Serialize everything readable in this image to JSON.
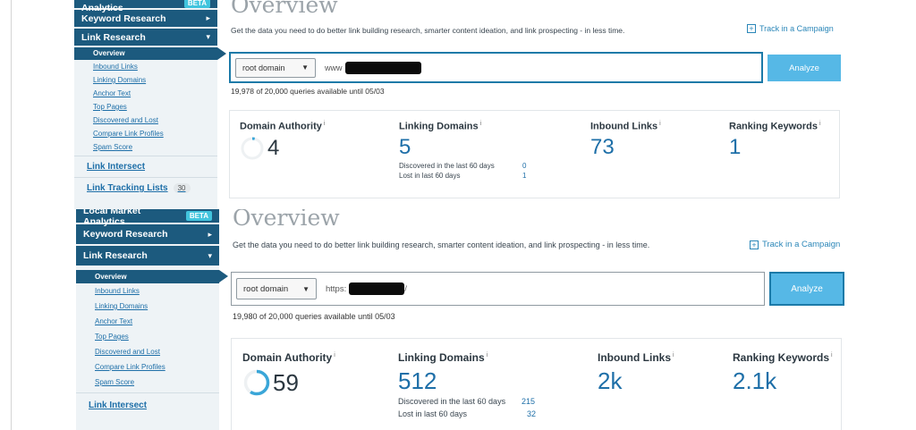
{
  "panels": [
    {
      "sidebar": {
        "local_market": "Local Market Analytics",
        "local_market_badge": "BETA",
        "keyword_research": "Keyword Research",
        "link_research": "Link Research",
        "subnav": [
          "Overview",
          "Inbound Links",
          "Linking Domains",
          "Anchor Text",
          "Top Pages",
          "Discovered and Lost",
          "Compare Link Profiles",
          "Spam Score"
        ],
        "link_intersect": "Link Intersect",
        "link_tracking": "Link Tracking Lists",
        "link_tracking_count": "30"
      },
      "main": {
        "title": "Overview",
        "subtitle": "Get the data you need to do better link building research, smarter content ideation, and link prospecting - in less time.",
        "track_campaign": "Track in a Campaign",
        "select_value": "root domain",
        "url_prefix": "www",
        "url_suffix": "",
        "analyze_label": "Analyze",
        "queries": "19,978 of 20,000 queries available until 05/03"
      },
      "metrics": {
        "domain_authority_label": "Domain Authority",
        "domain_authority_value": "4",
        "domain_authority_fraction": 0.04,
        "linking_domains_label": "Linking Domains",
        "linking_domains_value": "5",
        "discovered_label": "Discovered in the last 60 days",
        "discovered_value": "0",
        "lost_label": "Lost in last 60 days",
        "lost_value": "1",
        "inbound_links_label": "Inbound Links",
        "inbound_links_value": "73",
        "ranking_keywords_label": "Ranking Keywords",
        "ranking_keywords_value": "1",
        "info_mark": "i"
      }
    },
    {
      "sidebar": {
        "local_market": "Local Market Analytics",
        "local_market_badge": "BETA",
        "keyword_research": "Keyword Research",
        "link_research": "Link Research",
        "subnav": [
          "Overview",
          "Inbound Links",
          "Linking Domains",
          "Anchor Text",
          "Top Pages",
          "Discovered and Lost",
          "Compare Link Profiles",
          "Spam Score"
        ],
        "link_intersect": "Link Intersect"
      },
      "main": {
        "title": "Overview",
        "subtitle": "Get the data you need to do better link building research, smarter content ideation, and link prospecting - in less time.",
        "track_campaign": "Track in a Campaign",
        "select_value": "root domain",
        "url_prefix": "https:",
        "url_suffix": "/",
        "analyze_label": "Analyze",
        "queries": "19,980 of 20,000 queries available until 05/03"
      },
      "metrics": {
        "domain_authority_label": "Domain Authority",
        "domain_authority_value": "59",
        "domain_authority_fraction": 0.59,
        "linking_domains_label": "Linking Domains",
        "linking_domains_value": "512",
        "discovered_label": "Discovered in the last 60 days",
        "discovered_value": "215",
        "lost_label": "Lost in last 60 days",
        "lost_value": "32",
        "inbound_links_label": "Inbound Links",
        "inbound_links_value": "2k",
        "ranking_keywords_label": "Ranking Keywords",
        "ranking_keywords_value": "2.1k",
        "info_mark": "i"
      }
    }
  ],
  "icons": {
    "caret_right": "caret-right-icon",
    "caret_down": "caret-down-icon",
    "plus_box": "plus-box-icon",
    "select_arrow": "chevron-down-icon",
    "info": "info-icon",
    "da_ring": "progress-ring-icon"
  },
  "colors": {
    "nav_bg": "#1c5a7e",
    "link": "#1e6fa8",
    "badge": "#41c4dd",
    "analyze": "#56b8e6",
    "search_border": "#1c7aa8"
  }
}
